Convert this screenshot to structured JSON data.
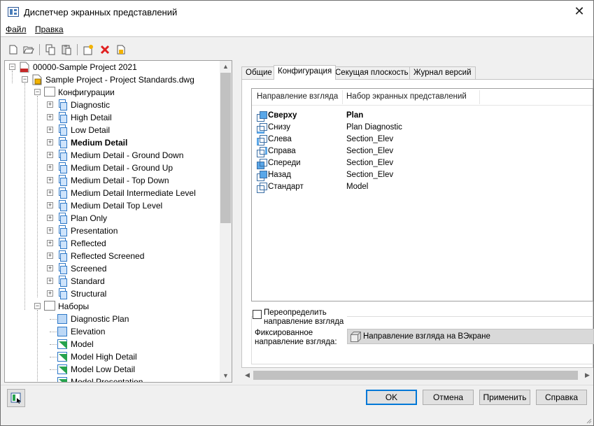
{
  "window": {
    "title": "Диспетчер экранных представлений",
    "close_glyph": "✕"
  },
  "menu": {
    "file": "Файл",
    "edit": "Правка"
  },
  "toolbar": {
    "buttons": [
      "new-icon",
      "open-icon",
      "copy-icon",
      "paste-icon",
      "new-set-icon",
      "delete-icon",
      "import-icon"
    ],
    "delete_glyph": "✕"
  },
  "tree": {
    "project": "00000-Sample Project 2021",
    "drawing": "Sample Project - Project Standards.dwg",
    "configs_folder": "Конфигурации",
    "configurations": [
      "Diagnostic",
      "High Detail",
      "Low Detail",
      "Medium Detail",
      "Medium Detail - Ground Down",
      "Medium Detail - Ground Up",
      "Medium Detail - Top Down",
      "Medium Detail Intermediate Level",
      "Medium Detail Top Level",
      "Plan Only",
      "Presentation",
      "Reflected",
      "Reflected Screened",
      "Screened",
      "Standard",
      "Structural"
    ],
    "sets_folder": "Наборы",
    "sets": [
      "Diagnostic Plan",
      "Elevation",
      "Model",
      "Model High Detail",
      "Model Low Detail",
      "Model Presentation"
    ],
    "scroll_up": "▲",
    "scroll_down": "▼"
  },
  "tabs": [
    "Общие",
    "Конфигурация",
    "Секущая плоскость",
    "Журнал версий"
  ],
  "list": {
    "col_direction": "Направление взгляда",
    "col_set": "Набор экранных представлений",
    "rows": [
      {
        "direction": "Сверху",
        "set": "Plan"
      },
      {
        "direction": "Снизу",
        "set": "Plan Diagnostic"
      },
      {
        "direction": "Слева",
        "set": "Section_Elev"
      },
      {
        "direction": "Справа",
        "set": "Section_Elev"
      },
      {
        "direction": "Спереди",
        "set": "Section_Elev"
      },
      {
        "direction": "Назад",
        "set": "Section_Elev"
      },
      {
        "direction": "Стандарт",
        "set": "Model"
      }
    ]
  },
  "override": {
    "label_line1": "Переопределить",
    "label_line2": "направление взгляда",
    "checked": false
  },
  "fixed": {
    "label_line1": "Фиксированное",
    "label_line2": "направление взгляда:",
    "value": "Направление взгляда на ВЭкране"
  },
  "hscroll": {
    "left": "◀",
    "right": "▶"
  },
  "buttons": {
    "ok": "OK",
    "cancel": "Отмена",
    "apply": "Применить",
    "help": "Справка"
  },
  "colors": {
    "accent": "#0078d7",
    "selection_icon": "#5aa7e8",
    "model_green": "#27a34e"
  }
}
